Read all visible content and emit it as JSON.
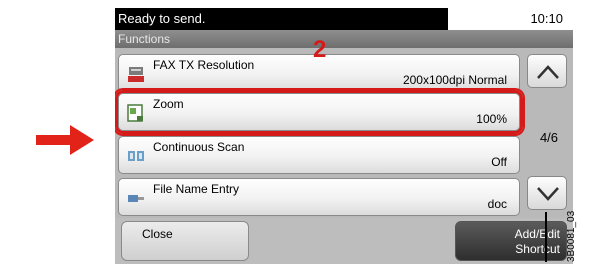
{
  "status": {
    "message": "Ready to send.",
    "time": "10:10"
  },
  "title": "Functions",
  "callout": "2",
  "items": [
    {
      "label": "FAX TX Resolution",
      "value": "200x100dpi Normal",
      "icon": "fax-resolution-icon"
    },
    {
      "label": "Zoom",
      "value": "100%",
      "icon": "zoom-icon"
    },
    {
      "label": "Continuous Scan",
      "value": "Off",
      "icon": "continuous-scan-icon"
    },
    {
      "label": "File Name Entry",
      "value": "doc",
      "icon": "file-name-entry-icon"
    }
  ],
  "page_indicator": "4/6",
  "buttons": {
    "close": "Close",
    "add_edit_line1": "Add/Edit",
    "add_edit_line2": "Shortcut"
  },
  "caption": "3B0081_03",
  "colors": {
    "highlight": "#d51a1a",
    "arrow": "#e2231a"
  }
}
